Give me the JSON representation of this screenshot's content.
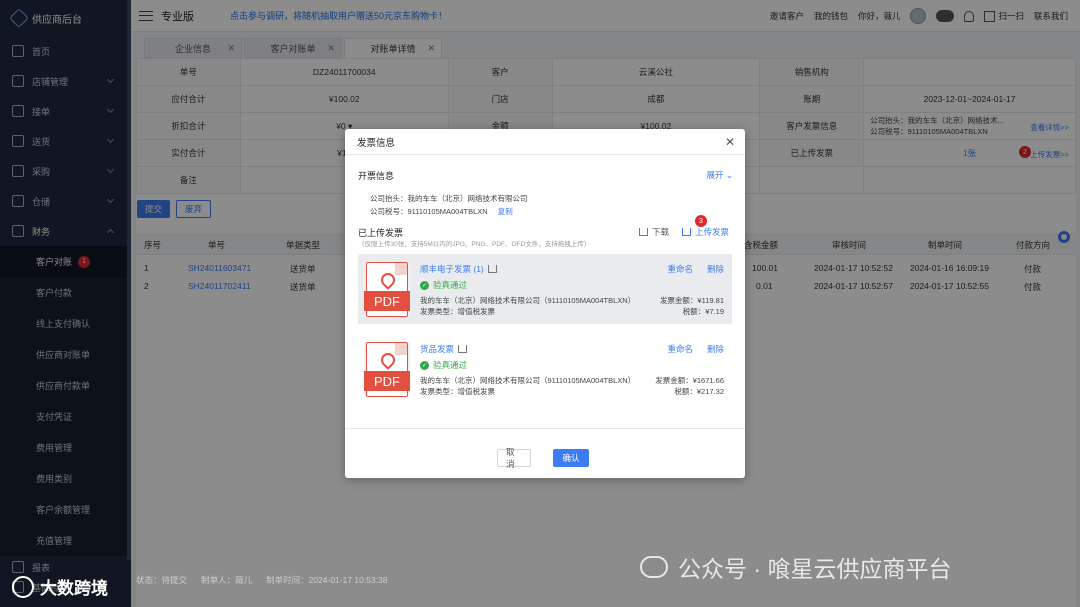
{
  "sidebar": {
    "brand": "供应商后台",
    "items": [
      {
        "label": "首页",
        "icon": "home-icon",
        "chevron": false
      },
      {
        "label": "店铺管理",
        "icon": "store-icon",
        "chevron": true
      },
      {
        "label": "接单",
        "icon": "clipboard-icon",
        "chevron": true
      },
      {
        "label": "送货",
        "icon": "truck-icon",
        "chevron": true
      },
      {
        "label": "采购",
        "icon": "cart-icon",
        "chevron": true
      },
      {
        "label": "仓储",
        "icon": "warehouse-icon",
        "chevron": true
      },
      {
        "label": "财务",
        "icon": "wallet-icon",
        "chevron": true
      }
    ],
    "finance_sub": [
      {
        "label": "客户对账",
        "active": true,
        "badge": "1"
      },
      {
        "label": "客户付款"
      },
      {
        "label": "线上支付确认"
      },
      {
        "label": "供应商对账单"
      },
      {
        "label": "供应商付款单"
      },
      {
        "label": "支付凭证"
      },
      {
        "label": "费用管理"
      },
      {
        "label": "费用类别"
      },
      {
        "label": "客户余额管理"
      },
      {
        "label": "充值管理"
      }
    ],
    "bottom_items": [
      {
        "label": "报表"
      },
      {
        "label": "基础档案"
      }
    ]
  },
  "topbar": {
    "edition": "专业版",
    "promo": "点击参与调研，将随机抽取用户赠送50元京东购物卡！",
    "invite": "邀请客户",
    "wallet": "我的钱包",
    "greeting": "你好，薇儿",
    "scan": "扫一扫",
    "contact": "联系我们"
  },
  "tabs": [
    {
      "label": "企业信息",
      "active": false
    },
    {
      "label": "客户对账单",
      "active": false
    },
    {
      "label": "对账单详情",
      "active": true
    }
  ],
  "detail": {
    "rows": [
      [
        "单号",
        "DZ24011700034",
        "客户",
        "云溪公社",
        "销售机构",
        ""
      ],
      [
        "应付合计",
        "¥100.02",
        "门店",
        "成都",
        "账期",
        "2023-12-01~2024-01-17"
      ],
      [
        "折扣合计",
        "¥0 ▾",
        "金额",
        "¥100.02",
        "客户发票信息",
        ""
      ],
      [
        "实付合计",
        "¥10",
        "",
        "",
        "已上传发票",
        "1张"
      ],
      [
        "备注",
        "",
        "",
        "",
        "",
        ""
      ]
    ],
    "invoice_info_lines": [
      "公司抬头：我的车车（北京）网络技术...",
      "公司税号：91110105MA004TBLXN"
    ],
    "view_detail": "查看详情>>",
    "upload_link": "上传发票>>",
    "badge_2": "2",
    "btn_submit": "提交",
    "btn_discard": "废弃"
  },
  "list": {
    "headers": [
      "序号",
      "单号",
      "单据类型",
      "含税金额",
      "审核时间",
      "制单时间",
      "付款方向"
    ],
    "rows": [
      [
        "1",
        "SH24011603471",
        "送货单",
        "100.01",
        "2024-01-17 10:52:52",
        "2024-01-16 16:09:19",
        "付款"
      ],
      [
        "2",
        "SH24011702411",
        "送货单",
        "0.01",
        "2024-01-17 10:52:57",
        "2024-01-17 10:52:55",
        "付款"
      ]
    ]
  },
  "footer": {
    "status_label": "状态：",
    "status_value": "待提交",
    "maker_label": "制单人：",
    "maker_value": "薇儿",
    "time_label": "制单时间：",
    "time_value": "2024-01-17 10:53:38"
  },
  "watermarks": {
    "left": "大数跨境",
    "right": "公众号 · 喰星云供应商平台"
  },
  "modal": {
    "title": "发票信息",
    "section_issue": "开票信息",
    "expand": "展开",
    "company_title": "公司抬头：我的车车（北京）网络技术有限公司",
    "tax_no": "公司税号：91110105MA004TBLXN",
    "copy": "复制",
    "section_uploaded": "已上传发票",
    "upload_hint": "（仅限上传30张，支持5M以内的JPG、PNG、PDF、OFD文件，支持拖拽上传）",
    "download": "下载",
    "upload": "上传发票",
    "badge_3": "3",
    "invoices": [
      {
        "name": "顺丰电子发票 (1)",
        "rename": "重命名",
        "delete": "删除",
        "status": "验真通过",
        "company": "我的车车（北京）网络技术有限公司（91110105MA004TBLXN）",
        "type": "发票类型：增值税发票",
        "amount": "发票金额：¥119.81",
        "tax": "税额：¥7.19",
        "pdf": "PDF"
      },
      {
        "name": "货品发票",
        "rename": "重命名",
        "delete": "删除",
        "status": "验真通过",
        "company": "我的车车（北京）网络技术有限公司（91110105MA004TBLXN）",
        "type": "发票类型：增值税发票",
        "amount": "发票金额：¥1671.66",
        "tax": "税额：¥217.32",
        "pdf": "PDF"
      }
    ],
    "cancel": "取消",
    "confirm": "确认"
  }
}
